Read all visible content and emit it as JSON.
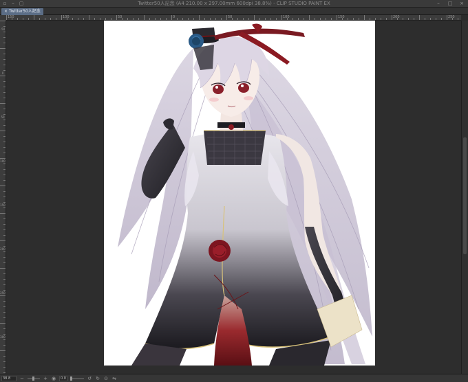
{
  "window": {
    "title": "Twitter50人記念 (A4 210.00 x 297.00mm 600dpi 38.8%) - CLIP STUDIO PAINT EX"
  },
  "tab": {
    "label": "Twitter50人記念"
  },
  "rulers": {
    "top_labels": [
      "150",
      "100",
      "50",
      "0",
      "50",
      "100",
      "150",
      "200",
      "250"
    ],
    "left_labels": [
      "-50",
      "0",
      "50",
      "100",
      "150",
      "200",
      "250",
      "300"
    ]
  },
  "statusbar": {
    "zoom": "38.8",
    "angle": "0.0"
  },
  "colors": {
    "canvas_bg": "#ffffff",
    "workspace_bg": "#2d2d2d",
    "tab_active": "#5b6d86"
  },
  "icons": {
    "zoom_out": "minus-icon",
    "zoom_in": "plus-icon",
    "fit": "fit-screen-icon",
    "rotate_left": "rotate-left-icon",
    "rotate_right": "rotate-right-icon",
    "reset_rotation": "reset-rotation-icon",
    "flip": "flip-horizontal-icon"
  }
}
